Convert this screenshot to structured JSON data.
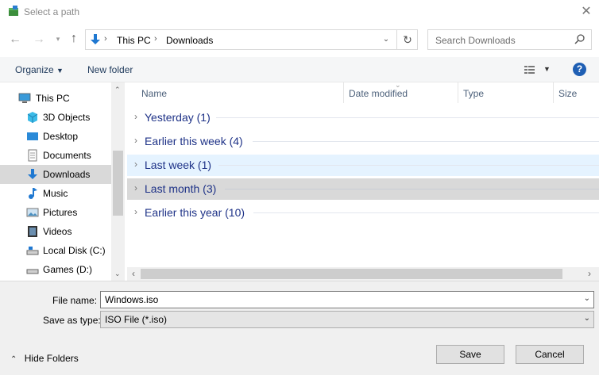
{
  "window": {
    "title": "Select a path"
  },
  "address": {
    "segments": [
      "This PC",
      "Downloads"
    ]
  },
  "search": {
    "placeholder": "Search Downloads"
  },
  "toolbar": {
    "organize": "Organize",
    "new_folder": "New folder"
  },
  "nav": {
    "items": [
      {
        "label": "This PC",
        "icon": "this-pc-icon"
      },
      {
        "label": "3D Objects",
        "icon": "3d-objects-icon"
      },
      {
        "label": "Desktop",
        "icon": "desktop-icon"
      },
      {
        "label": "Documents",
        "icon": "documents-icon"
      },
      {
        "label": "Downloads",
        "icon": "downloads-icon",
        "selected": true
      },
      {
        "label": "Music",
        "icon": "music-icon"
      },
      {
        "label": "Pictures",
        "icon": "pictures-icon"
      },
      {
        "label": "Videos",
        "icon": "videos-icon"
      },
      {
        "label": "Local Disk (C:)",
        "icon": "drive-icon"
      },
      {
        "label": "Games (D:)",
        "icon": "drive-icon"
      }
    ]
  },
  "columns": [
    "Name",
    "Date modified",
    "Type",
    "Size"
  ],
  "groups": [
    {
      "label": "Yesterday (1)"
    },
    {
      "label": "Earlier this week (4)"
    },
    {
      "label": "Last week (1)",
      "state": "hover"
    },
    {
      "label": "Last month (3)",
      "state": "selected"
    },
    {
      "label": "Earlier this year (10)"
    }
  ],
  "form": {
    "file_name_label": "File name:",
    "file_name_value": "Windows.iso",
    "type_label": "Save as type:",
    "type_value": "ISO File (*.iso)"
  },
  "footer": {
    "hide_folders": "Hide Folders",
    "save": "Save",
    "cancel": "Cancel"
  },
  "colors": {
    "accent": "#0078d7",
    "group_text": "#1e3287",
    "hover_row": "#e5f3ff",
    "selected_row": "#d9d9d9"
  }
}
